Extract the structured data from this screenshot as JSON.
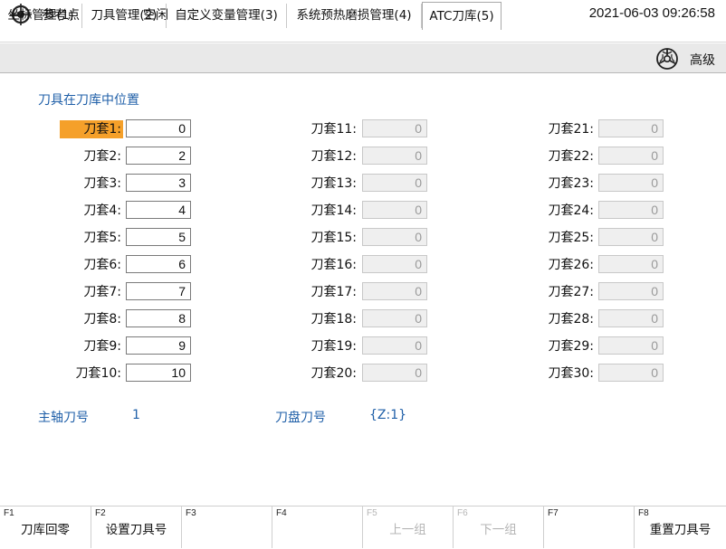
{
  "header": {
    "ref_label": "参考点",
    "state": "空闲",
    "datetime": "2021-06-03 09:26:58"
  },
  "tabs": [
    {
      "label": "坐标管理(1)"
    },
    {
      "label": "刀具管理(2)"
    },
    {
      "label": "自定义变量管理(3)"
    },
    {
      "label": "系统预热磨损管理(4)"
    },
    {
      "label": "ATC刀库(5)",
      "active": true
    }
  ],
  "advanced_label": "高级",
  "section_title": "刀具在刀库中位置",
  "tool_slots": {
    "col1": [
      {
        "label": "刀套1:",
        "value": "0"
      },
      {
        "label": "刀套2:",
        "value": "2"
      },
      {
        "label": "刀套3:",
        "value": "3"
      },
      {
        "label": "刀套4:",
        "value": "4"
      },
      {
        "label": "刀套5:",
        "value": "5"
      },
      {
        "label": "刀套6:",
        "value": "6"
      },
      {
        "label": "刀套7:",
        "value": "7"
      },
      {
        "label": "刀套8:",
        "value": "8"
      },
      {
        "label": "刀套9:",
        "value": "9"
      },
      {
        "label": "刀套10:",
        "value": "10"
      }
    ],
    "col2": [
      {
        "label": "刀套11:",
        "value": "0"
      },
      {
        "label": "刀套12:",
        "value": "0"
      },
      {
        "label": "刀套13:",
        "value": "0"
      },
      {
        "label": "刀套14:",
        "value": "0"
      },
      {
        "label": "刀套15:",
        "value": "0"
      },
      {
        "label": "刀套16:",
        "value": "0"
      },
      {
        "label": "刀套17:",
        "value": "0"
      },
      {
        "label": "刀套18:",
        "value": "0"
      },
      {
        "label": "刀套19:",
        "value": "0"
      },
      {
        "label": "刀套20:",
        "value": "0"
      }
    ],
    "col3": [
      {
        "label": "刀套21:",
        "value": "0"
      },
      {
        "label": "刀套22:",
        "value": "0"
      },
      {
        "label": "刀套23:",
        "value": "0"
      },
      {
        "label": "刀套24:",
        "value": "0"
      },
      {
        "label": "刀套25:",
        "value": "0"
      },
      {
        "label": "刀套26:",
        "value": "0"
      },
      {
        "label": "刀套27:",
        "value": "0"
      },
      {
        "label": "刀套28:",
        "value": "0"
      },
      {
        "label": "刀套29:",
        "value": "0"
      },
      {
        "label": "刀套30:",
        "value": "0"
      }
    ]
  },
  "spindle": {
    "label": "主轴刀号",
    "value": "1"
  },
  "magazine": {
    "label": "刀盘刀号",
    "value": "{Z:1}"
  },
  "fkeys": [
    {
      "key": "F1",
      "label": "刀库回零",
      "enabled": true
    },
    {
      "key": "F2",
      "label": "设置刀具号",
      "enabled": true
    },
    {
      "key": "F3",
      "label": "",
      "enabled": true
    },
    {
      "key": "F4",
      "label": "",
      "enabled": true
    },
    {
      "key": "F5",
      "label": "上一组",
      "enabled": false
    },
    {
      "key": "F6",
      "label": "下一组",
      "enabled": false
    },
    {
      "key": "F7",
      "label": "",
      "enabled": true
    },
    {
      "key": "F8",
      "label": "重置刀具号",
      "enabled": true
    }
  ],
  "colors": {
    "accent_blue": "#1f5fa8",
    "selected_orange": "#f5a02a"
  },
  "icons": {
    "logo": "crosshair-target-icon",
    "advanced": "gear-wheel-icon"
  }
}
